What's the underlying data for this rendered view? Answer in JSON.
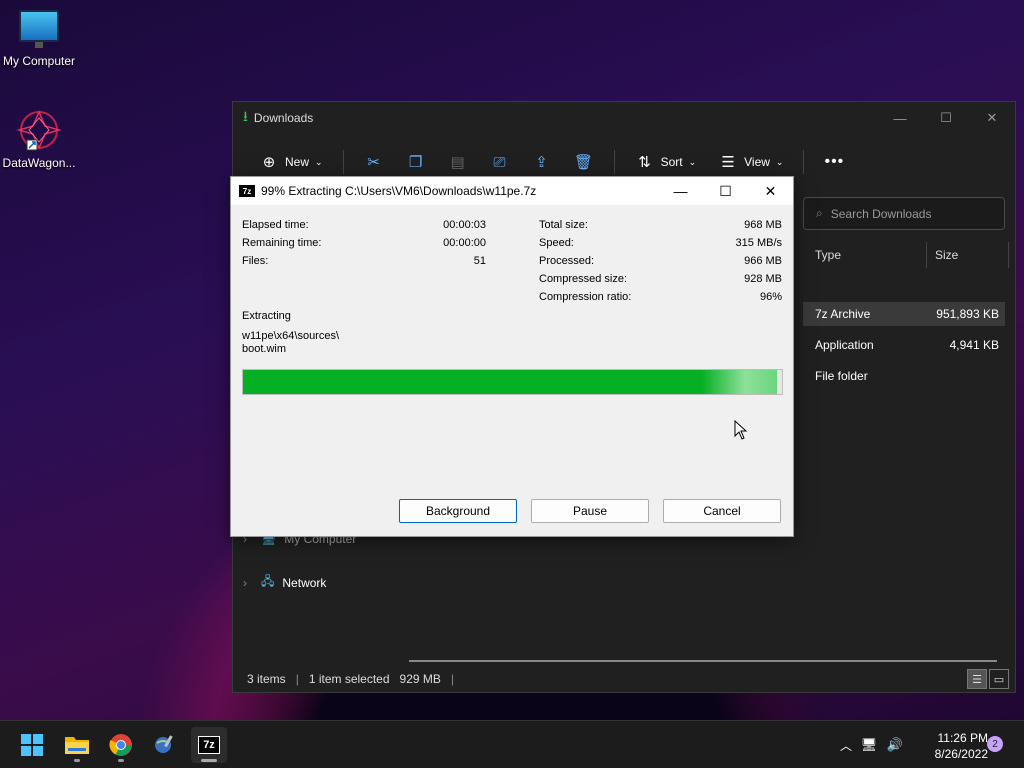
{
  "desktop": {
    "icons": [
      {
        "label": "My Computer"
      },
      {
        "label": "DataWagon..."
      }
    ]
  },
  "explorer": {
    "title": "Downloads",
    "toolbar": {
      "new_label": "New",
      "sort_label": "Sort",
      "view_label": "View"
    },
    "search_placeholder": "Search Downloads",
    "columns": {
      "type": "Type",
      "size": "Size"
    },
    "rows": [
      {
        "type": "7z Archive",
        "size": "951,893 KB"
      },
      {
        "type": "Application",
        "size": "4,941 KB"
      },
      {
        "type": "File folder",
        "size": ""
      }
    ],
    "nav": [
      {
        "label": "My Computer"
      },
      {
        "label": "Network"
      }
    ],
    "status": {
      "items": "3 items",
      "selected": "1 item selected",
      "size": "929 MB"
    }
  },
  "zip_dialog": {
    "title": "99% Extracting C:\\Users\\VM6\\Downloads\\w11pe.7z",
    "left_stats": [
      {
        "label": "Elapsed time:",
        "value": "00:00:03"
      },
      {
        "label": "Remaining time:",
        "value": "00:00:00"
      },
      {
        "label": "Files:",
        "value": "51"
      }
    ],
    "right_stats": [
      {
        "label": "Total size:",
        "value": "968 MB"
      },
      {
        "label": "Speed:",
        "value": "315 MB/s"
      },
      {
        "label": "Processed:",
        "value": "966 MB"
      },
      {
        "label": "Compressed size:",
        "value": "928 MB"
      },
      {
        "label": "Compression ratio:",
        "value": "96%"
      }
    ],
    "extracting_label": "Extracting",
    "current_path": "w11pe\\x64\\sources\\",
    "current_file": "boot.wim",
    "progress_fraction": 0.99,
    "buttons": {
      "background": "Background",
      "pause": "Pause",
      "cancel": "Cancel"
    },
    "progress_color": "#06b025"
  },
  "taskbar": {
    "time": "11:26 PM",
    "date": "8/26/2022",
    "notification_count": "2"
  }
}
